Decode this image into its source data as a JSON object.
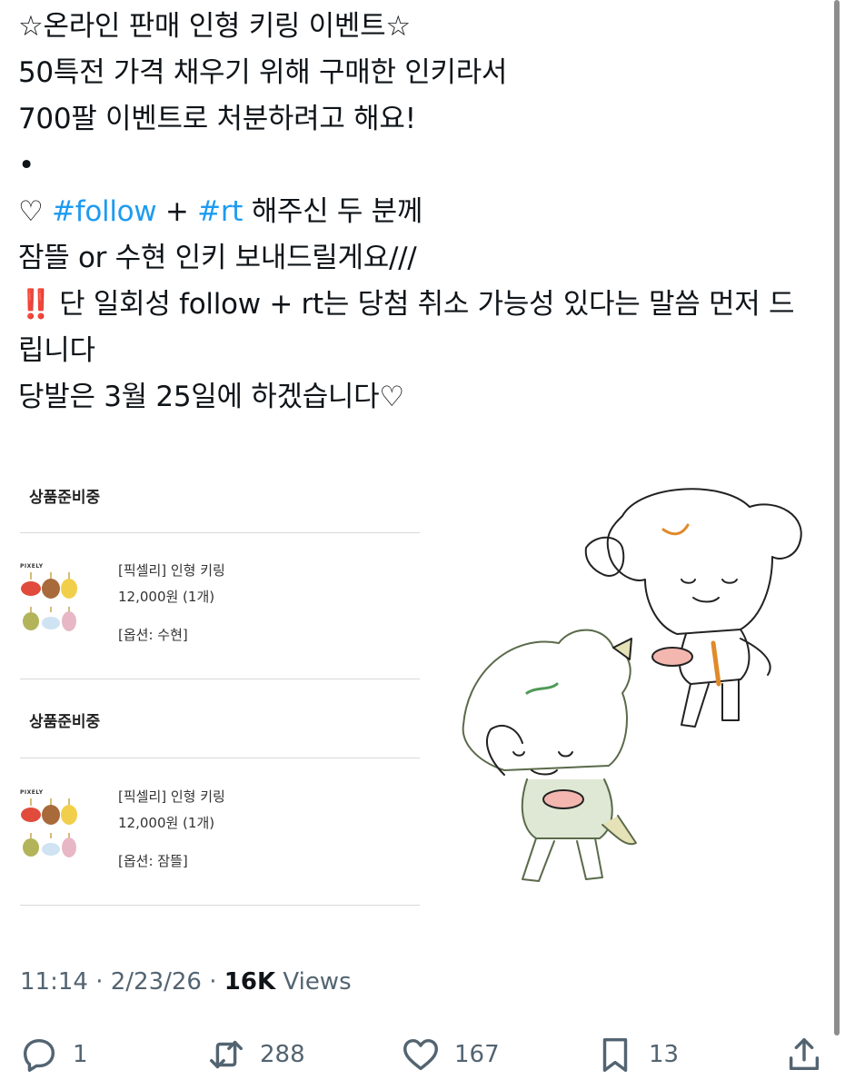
{
  "tweet": {
    "lines": [
      "☆온라인 판매 인형 키링 이벤트☆",
      "50특전 가격 채우기 위해 구매한 인키라서",
      "700팔 이벤트로 처분하려고 해요!",
      "•"
    ],
    "line5_prefix": "♡ ",
    "hashtag_follow": "#follow",
    "plus": " + ",
    "hashtag_rt": "#rt",
    "line5_suffix": " 해주신 두 분께",
    "line6": "잠뜰 or 수현 인키 보내드릴게요///",
    "alert_icon": "‼️",
    "line7": " 단 일회성 follow + rt는 당첨 취소 가능성 있다는 말씀 먼저 드립니다",
    "line8": "당발은 3월 25일에 하겠습니다♡",
    "hashtag_color": "#1d9bf0"
  },
  "orders": [
    {
      "status": "상품준비중",
      "brand": "PIXELY",
      "product": "[픽셀리] 인형 키링",
      "price": "12,000원 (1개)",
      "option": "[옵션: 수현]"
    },
    {
      "status": "상품준비중",
      "brand": "PIXELY",
      "product": "[픽셀리] 인형 키링",
      "price": "12,000원 (1개)",
      "option": "[옵션: 잠뜰]"
    }
  ],
  "meta": {
    "time": "11:14",
    "sep1": " · ",
    "date": "2/23/26",
    "sep2": " · ",
    "views_count": "16K",
    "views_label": " Views"
  },
  "actions": {
    "reply": {
      "icon": "reply-icon",
      "count": "1"
    },
    "repost": {
      "icon": "repost-icon",
      "count": "288"
    },
    "like": {
      "icon": "heart-icon",
      "count": "167"
    },
    "bookmark": {
      "icon": "bookmark-icon",
      "count": "13"
    },
    "share": {
      "icon": "share-icon"
    }
  }
}
